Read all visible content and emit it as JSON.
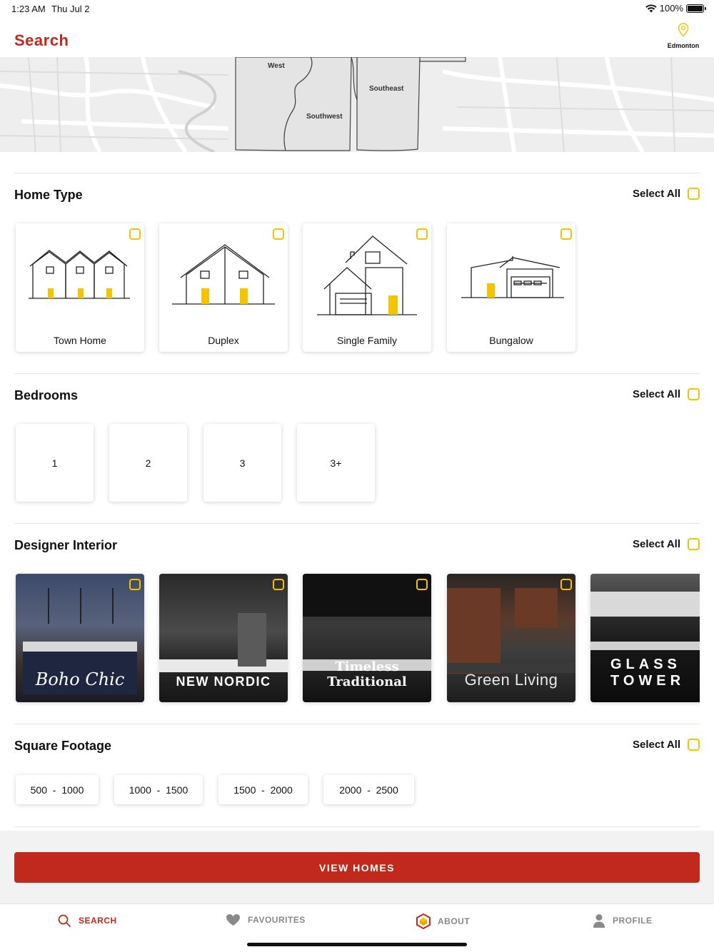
{
  "status_bar": {
    "time": "1:23 AM",
    "date": "Thu Jul 2",
    "battery": "100%"
  },
  "header": {
    "title": "Search",
    "location_label": "Edmonton"
  },
  "map": {
    "regions": [
      "West",
      "Southeast",
      "Southwest"
    ]
  },
  "home_type": {
    "title": "Home Type",
    "select_all": "Select All",
    "items": [
      {
        "label": "Town Home",
        "icon": "townhome-icon"
      },
      {
        "label": "Duplex",
        "icon": "duplex-icon"
      },
      {
        "label": "Single Family",
        "icon": "single-family-icon"
      },
      {
        "label": "Bungalow",
        "icon": "bungalow-icon"
      }
    ]
  },
  "bedrooms": {
    "title": "Bedrooms",
    "select_all": "Select All",
    "items": [
      "1",
      "2",
      "3",
      "3+"
    ]
  },
  "designer_interior": {
    "title": "Designer Interior",
    "select_all": "Select All",
    "items": [
      {
        "label": "Boho Chic"
      },
      {
        "label": "NEW NORDIC"
      },
      {
        "label": "Timeless Traditional"
      },
      {
        "label": "Green Living"
      },
      {
        "label": "GLASS TOWER"
      }
    ]
  },
  "square_footage": {
    "title": "Square Footage",
    "select_all": "Select All",
    "items": [
      "500  -  1000",
      "1000  -  1500",
      "1500  -  2000",
      "2000  -  2500"
    ]
  },
  "actions": {
    "view_homes": "VIEW HOMES"
  },
  "tabs": [
    {
      "label": "SEARCH",
      "icon": "search-icon"
    },
    {
      "label": "FAVOURITES",
      "icon": "heart-icon"
    },
    {
      "label": "ABOUT",
      "icon": "hexagon-logo-icon"
    },
    {
      "label": "PROFILE",
      "icon": "person-icon"
    }
  ],
  "colors": {
    "brand_red": "#c0291b",
    "accent_yellow": "#f5c400"
  }
}
